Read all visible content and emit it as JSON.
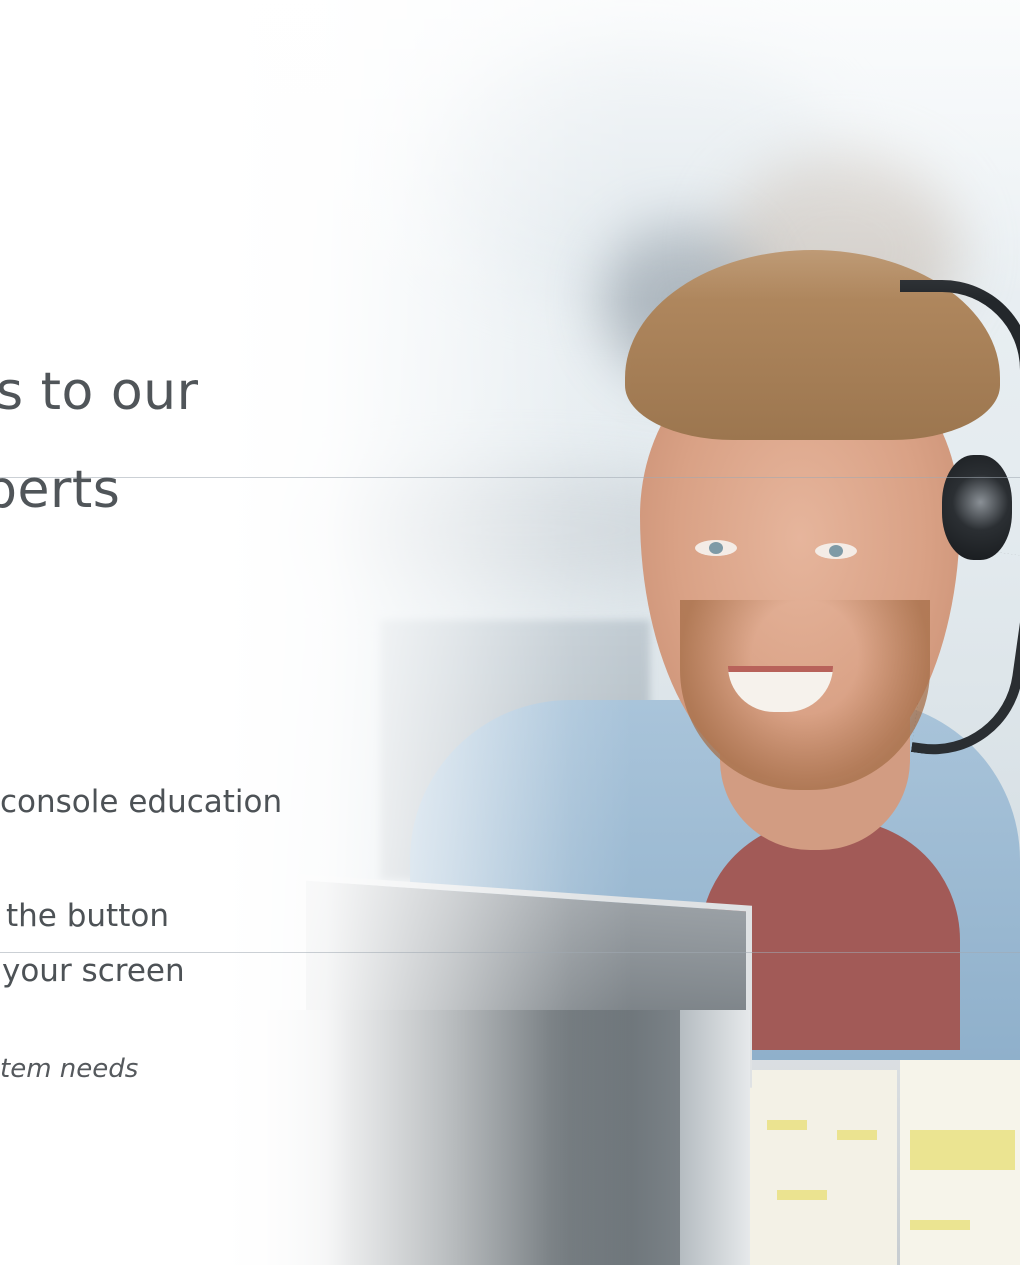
{
  "hero": {
    "heading_line1": "s to our",
    "heading_line2": "perts",
    "line1": "console education",
    "line2": "the button",
    "line3": "your screen",
    "note": "tem needs"
  }
}
